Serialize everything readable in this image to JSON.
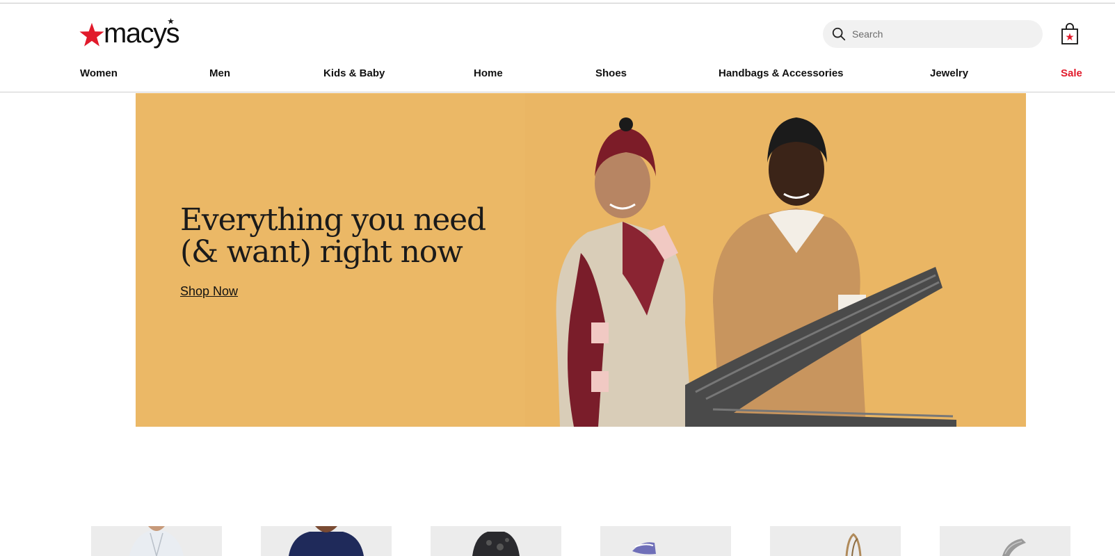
{
  "brand": {
    "name": "macy's",
    "logo_text": "macys",
    "accent_color": "#e11a2b"
  },
  "header": {
    "search": {
      "placeholder": "Search",
      "value": ""
    },
    "bag_icon": "shopping-bag-icon"
  },
  "nav": {
    "items": [
      {
        "label": "Women"
      },
      {
        "label": "Men"
      },
      {
        "label": "Kids & Baby"
      },
      {
        "label": "Home"
      },
      {
        "label": "Shoes"
      },
      {
        "label": "Handbags & Accessories"
      },
      {
        "label": "Jewelry"
      },
      {
        "label": "Sale",
        "color": "#e11a2b"
      }
    ]
  },
  "hero": {
    "headline_line1": "Everything you need",
    "headline_line2": "(& want) right now",
    "cta_label": "Shop Now",
    "background_color": "#ebb866"
  },
  "category_thumbnails": [
    {
      "icon": "women-shirt-image"
    },
    {
      "icon": "men-tshirt-image"
    },
    {
      "icon": "kids-shirt-image"
    },
    {
      "icon": "shoe-image"
    },
    {
      "icon": "handbag-image"
    },
    {
      "icon": "watch-image"
    }
  ]
}
